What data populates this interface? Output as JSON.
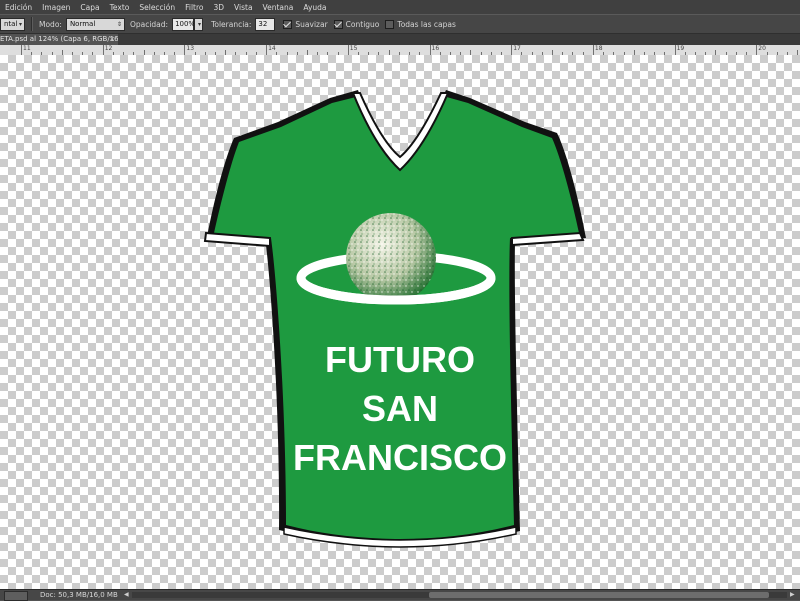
{
  "menubar": {
    "items": [
      "Edición",
      "Imagen",
      "Capa",
      "Texto",
      "Selección",
      "Filtro",
      "3D",
      "Vista",
      "Ventana",
      "Ayuda"
    ]
  },
  "options": {
    "first_select": "ntal",
    "mode_label": "Modo:",
    "mode_value": "Normal",
    "opacity_label": "Opacidad:",
    "opacity_value": "100%",
    "tolerance_label": "Tolerancia:",
    "tolerance_value": "32",
    "smooth_label": "Suavizar",
    "smooth_checked": true,
    "contiguous_label": "Contiguo",
    "contiguous_checked": true,
    "all_layers_label": "Todas las capas",
    "all_layers_checked": false
  },
  "document_tab": {
    "title": "ETA.psd al 124% (Capa 6, RGB/16) *",
    "close_icon": "close-icon"
  },
  "ruler": {
    "numbers": [
      "11",
      "12",
      "13",
      "14",
      "15",
      "16",
      "17",
      "18",
      "19",
      "20"
    ]
  },
  "artwork": {
    "lines": [
      "FUTURO",
      "SAN",
      "FRANCISCO"
    ],
    "shirt_color": "#1e9a40",
    "trim_color": "#ffffff",
    "outline_color": "#111111"
  },
  "statusbar": {
    "doc_info": "Doc: 50,3 MB/16,0 MB"
  }
}
